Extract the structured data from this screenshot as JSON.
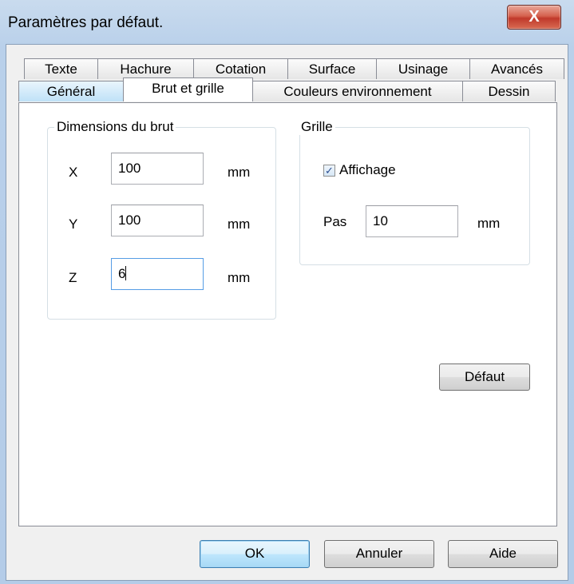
{
  "window": {
    "title": "Paramètres par défaut.",
    "close_glyph": "X"
  },
  "tabs_row1": [
    "Texte",
    "Hachure",
    "Cotation",
    "Surface",
    "Usinage",
    "Avancés"
  ],
  "tabs_row2": [
    "Général",
    "Brut et grille",
    "Couleurs environnement",
    "Dessin"
  ],
  "brut": {
    "title": "Dimensions du brut",
    "x_label": "X",
    "x_value": "100",
    "x_unit": "mm",
    "y_label": "Y",
    "y_value": "100",
    "y_unit": "mm",
    "z_label": "Z",
    "z_value": "6",
    "z_unit": "mm"
  },
  "grille": {
    "title": "Grille",
    "affichage_label": "Affichage",
    "affichage_checked": true,
    "pas_label": "Pas",
    "pas_value": "10",
    "pas_unit": "mm"
  },
  "buttons": {
    "defaut": "Défaut",
    "ok": "OK",
    "annuler": "Annuler",
    "aide": "Aide"
  },
  "colors": {
    "tab_highlight": "#bfe1f7",
    "focus_border": "#569de5",
    "close_red": "#c0392b"
  }
}
